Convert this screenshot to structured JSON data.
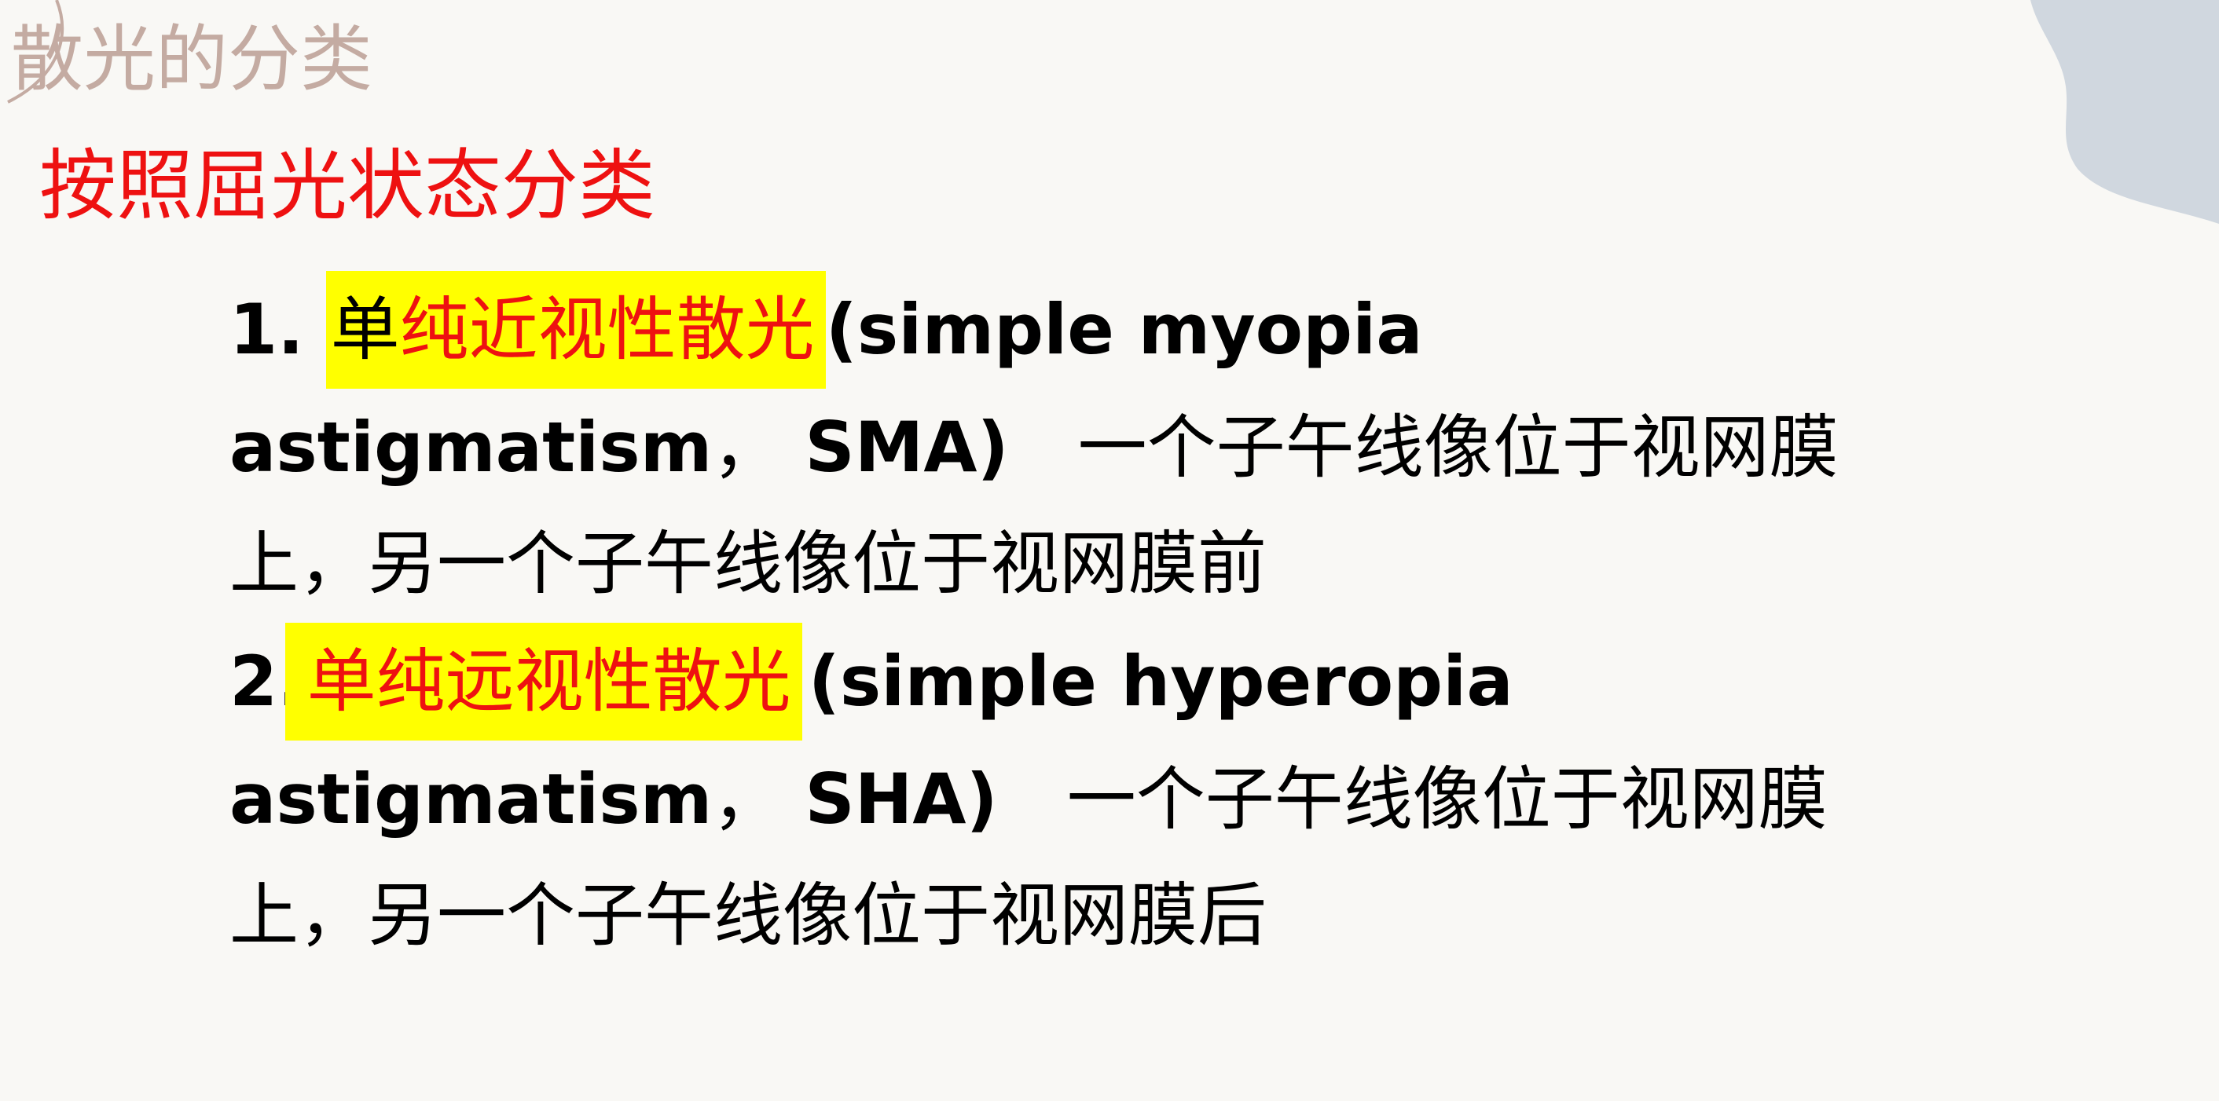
{
  "slide": {
    "section_title": "散光的分类",
    "subtitle": "按照屈光状态分类",
    "item1": {
      "number": "1.",
      "name_first_char": "单",
      "name_rest": "纯近视性散光",
      "english_part1": "(simple myopia",
      "english_part2": "astigmatism",
      "comma": "，",
      "abbr": "SMA)",
      "desc_part1": "一个子午线像位于视网膜",
      "desc_part2": "上，另一个子午线像位于视网膜前"
    },
    "item2": {
      "number": "2.",
      "name": "单纯远视性散光",
      "english_part1": "(simple hyperopia",
      "english_part2": "astigmatism",
      "comma": "，",
      "abbr": "SHA)",
      "desc_part1": "一个子午线像位于视网膜",
      "desc_part2": "上，另一个子午线像位于视网膜后"
    }
  },
  "colors": {
    "background": "#f9f8f5",
    "heading_red": "#ee1111",
    "highlight_yellow": "#ffff00",
    "section_title_tan": "#c4aba2",
    "corner_blob_gray": "#d0d7df"
  }
}
